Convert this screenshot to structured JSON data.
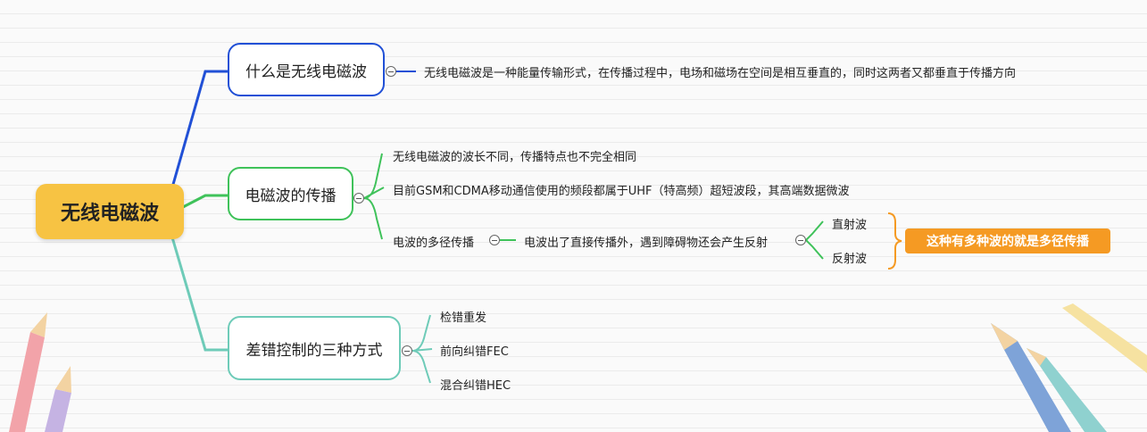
{
  "root": {
    "label": "无线电磁波"
  },
  "topics": [
    {
      "label": "什么是无线电磁波",
      "children": [
        "无线电磁波是一种能量传输形式，在传播过程中，电场和磁场在空间是相互垂直的，同时这两者又都垂直于传播方向"
      ]
    },
    {
      "label": "电磁波的传播",
      "children": [
        "无线电磁波的波长不同，传播特点也不完全相同",
        "目前GSM和CDMA移动通信使用的频段都属于UHF（特高频）超短波段，其高端数据微波",
        "电波的多径传播"
      ],
      "multipath": {
        "detail": "电波出了直接传播外，遇到障碍物还会产生反射",
        "waves": [
          "直射波",
          "反射波"
        ],
        "summary": "这种有多种波的就是多径传播"
      }
    },
    {
      "label": "差错控制的三种方式",
      "children": [
        "检错重发",
        "前向纠错FEC",
        "混合纠错HEC"
      ]
    }
  ],
  "colors": {
    "root": "#f7c343",
    "branch1": "#2150d6",
    "branch2": "#3fc25a",
    "branch3": "#6ecbb8",
    "summary": "#f59a23"
  }
}
